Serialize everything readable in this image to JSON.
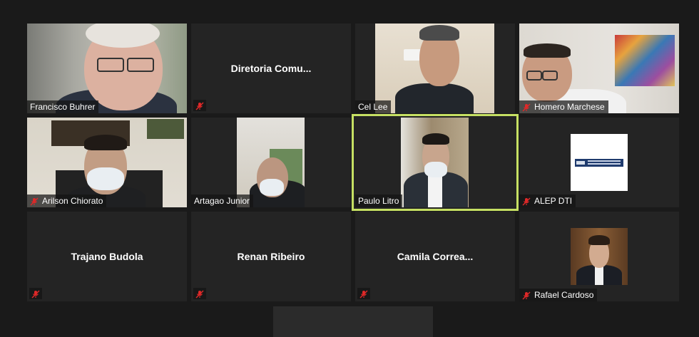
{
  "participants": [
    {
      "name": "Francisco Buhrer",
      "video": true,
      "muted": false
    },
    {
      "name": "Diretoria  Comu...",
      "video": false,
      "muted": true
    },
    {
      "name": "Cel Lee",
      "video": true,
      "muted": false
    },
    {
      "name": "Homero Marchese",
      "video": true,
      "muted": true
    },
    {
      "name": "Arilson Chiorato",
      "video": true,
      "muted": true
    },
    {
      "name": "Artagao Junior",
      "video": true,
      "muted": false
    },
    {
      "name": "Paulo Litro",
      "video": true,
      "muted": false,
      "active_speaker": true
    },
    {
      "name": "ALEP DTI",
      "video": true,
      "muted": true
    },
    {
      "name": "Trajano Budola",
      "video": false,
      "muted": true
    },
    {
      "name": "Renan Ribeiro",
      "video": false,
      "muted": true
    },
    {
      "name": "Camila  Correa...",
      "video": false,
      "muted": true
    },
    {
      "name": "Rafael Cardoso",
      "video": true,
      "muted": true
    }
  ],
  "colors": {
    "background": "#1a1a1a",
    "tile": "#242424",
    "active_speaker_border": "#c6e063",
    "muted_icon": "#e02828"
  },
  "icons": {
    "muted": "microphone-muted-icon"
  }
}
